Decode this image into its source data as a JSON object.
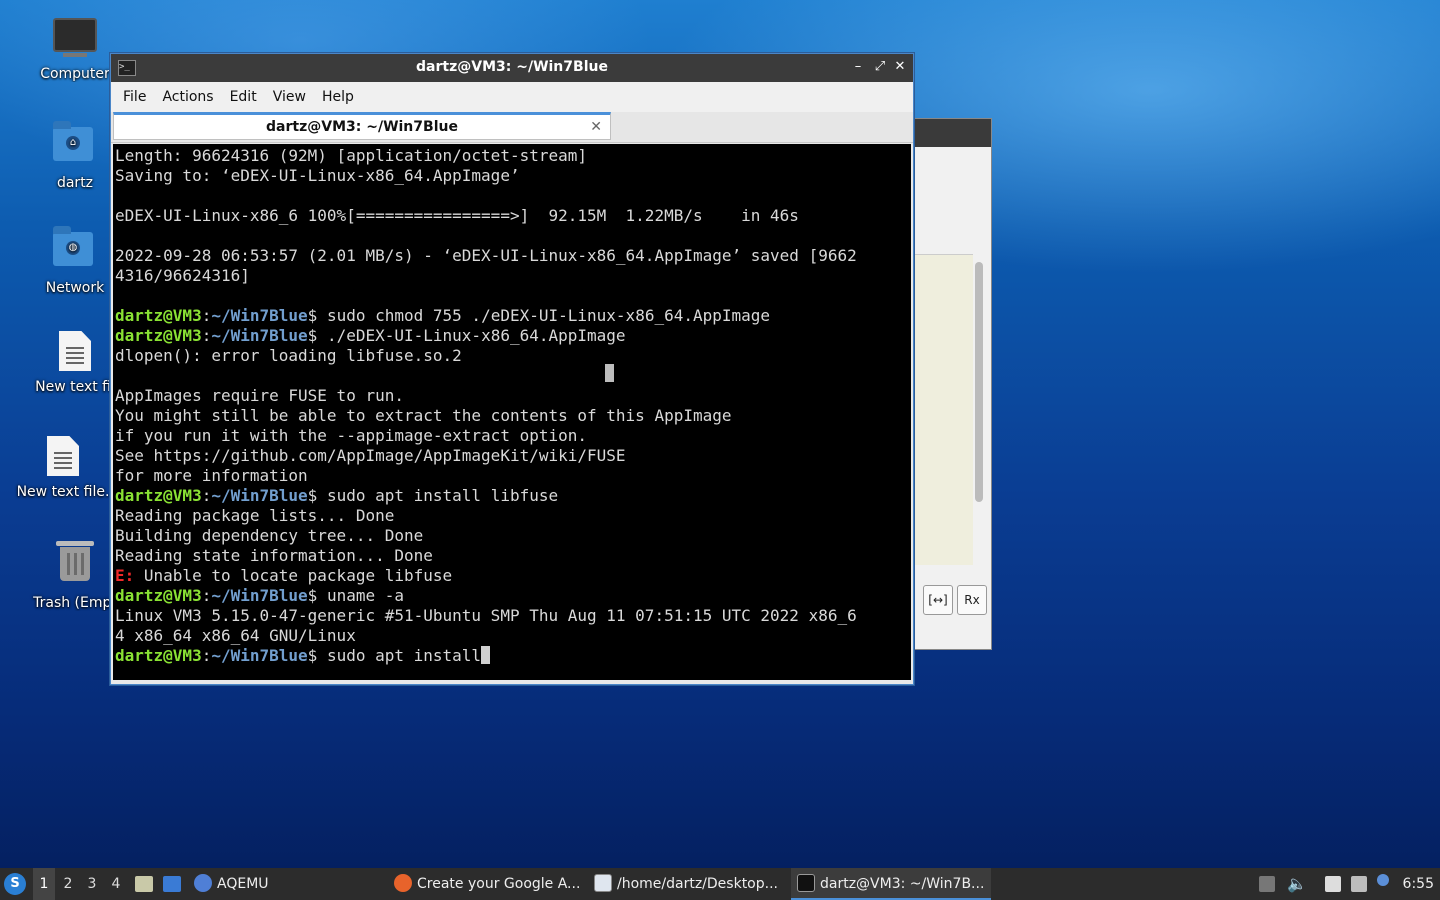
{
  "desktop": {
    "icons": [
      {
        "label": "Computer"
      },
      {
        "label": "dartz"
      },
      {
        "label": "Network"
      },
      {
        "label": "New text fil"
      },
      {
        "label": "New text file."
      },
      {
        "label": "Trash (Empt"
      }
    ]
  },
  "terminal": {
    "window_title": "dartz@VM3: ~/Win7Blue",
    "menu": [
      "File",
      "Actions",
      "Edit",
      "View",
      "Help"
    ],
    "tab_title": "dartz@VM3: ~/Win7Blue",
    "prompt_user": "dartz@VM3",
    "prompt_sep": ":",
    "prompt_path": "~/Win7Blue",
    "lines": {
      "l1": "Length: 96624316 (92M) [application/octet-stream]",
      "l2": "Saving to: ‘eDEX-UI-Linux-x86_64.AppImage’",
      "l3": "eDEX-UI-Linux-x86_6 100%[================>]  92.15M  1.22MB/s    in 46s",
      "l4": "2022-09-28 06:53:57 (2.01 MB/s) - ‘eDEX-UI-Linux-x86_64.AppImage’ saved [9662",
      "l5": "4316/96624316]",
      "c1": "$ sudo chmod 755 ./eDEX-UI-Linux-x86_64.AppImage",
      "c2": "$ ./eDEX-UI-Linux-x86_64.AppImage",
      "l6": "dlopen(): error loading libfuse.so.2",
      "l7": "AppImages require FUSE to run.",
      "l8": "You might still be able to extract the contents of this AppImage",
      "l9": "if you run it with the --appimage-extract option.",
      "l10": "See https://github.com/AppImage/AppImageKit/wiki/FUSE",
      "l11": "for more information",
      "c3": "$ sudo apt install libfuse",
      "l12": "Reading package lists... Done",
      "l13": "Building dependency tree... Done",
      "l14": "Reading state information... Done",
      "err_prefix": "E:",
      "l15": " Unable to locate package libfuse",
      "c4": "$ uname -a",
      "l16": "Linux VM3 5.15.0-47-generic #51-Ubuntu SMP Thu Aug 11 07:51:15 UTC 2022 x86_6",
      "l17": "4 x86_64 x86_64 GNU/Linux",
      "c5": "$ sudo apt install"
    }
  },
  "background_window": {
    "buttons": [
      "[↔]",
      "Rx"
    ]
  },
  "taskbar": {
    "workspaces": [
      "1",
      "2",
      "3",
      "4"
    ],
    "launcher_label": "AQEMU",
    "tasks": [
      {
        "label": "Create your Google A..."
      },
      {
        "label": "/home/dartz/Desktop..."
      },
      {
        "label": "dartz@VM3: ~/Win7B..."
      }
    ],
    "clock": "6:55"
  },
  "colors": {
    "prompt_user": "#8ae234",
    "prompt_path": "#729fcf",
    "error": "#ef2929",
    "accent": "#4a90d9"
  }
}
